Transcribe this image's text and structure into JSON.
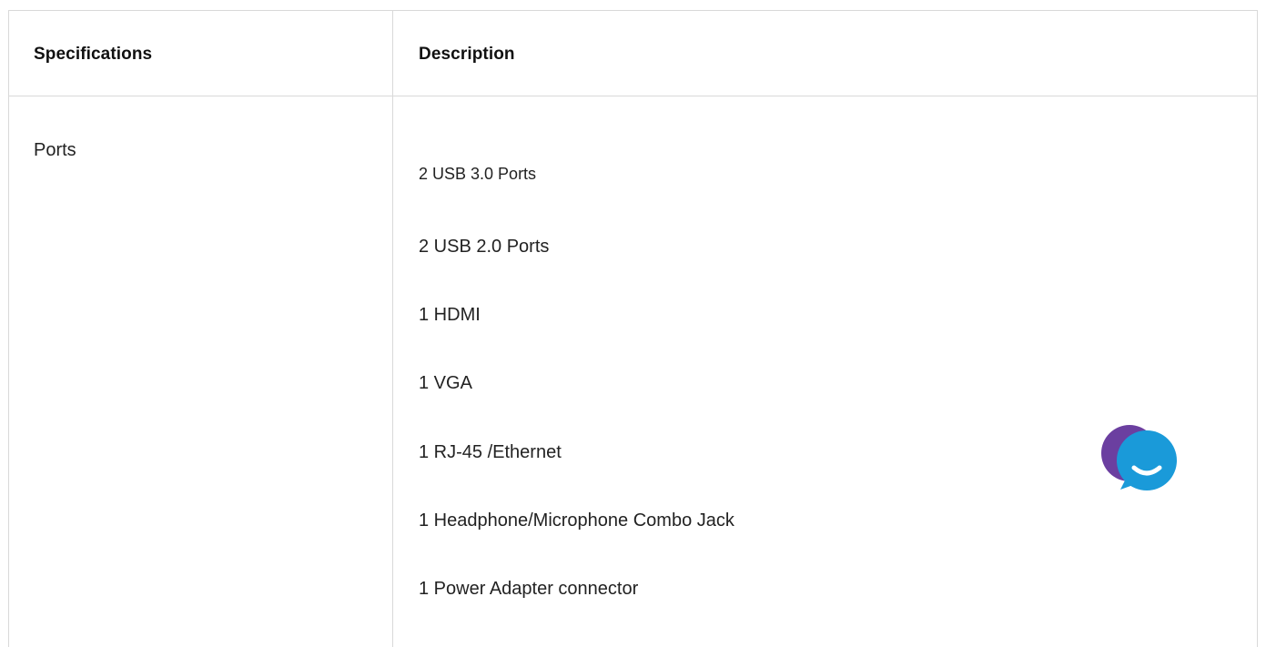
{
  "table": {
    "headers": {
      "specifications": "Specifications",
      "description": "Description"
    },
    "rows": [
      {
        "label": "Ports",
        "items": [
          "2 USB 3.0 Ports",
          "2 USB 2.0 Ports",
          "1 HDMI",
          "1 VGA",
          "1 RJ-45 /Ethernet",
          "1 Headphone/Microphone Combo Jack",
          "1 Power Adapter connector"
        ]
      }
    ]
  },
  "chat_widget": {
    "icon": "chat-bubble-icon",
    "colors": {
      "back_bubble": "#6b3fa0",
      "front_bubble": "#1a9ad9",
      "smile": "#ffffff"
    }
  }
}
